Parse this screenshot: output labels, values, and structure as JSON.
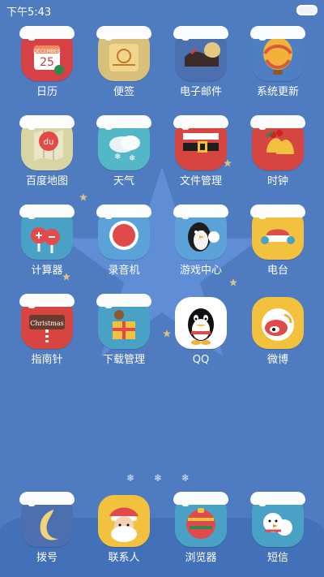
{
  "status_bar": {
    "time": "下午5:43"
  },
  "apps": [
    {
      "label": "日历",
      "icon": "calendar-icon"
    },
    {
      "label": "便签",
      "icon": "note-icon"
    },
    {
      "label": "电子邮件",
      "icon": "mail-icon"
    },
    {
      "label": "系统更新",
      "icon": "update-balloon-icon"
    },
    {
      "label": "百度地图",
      "icon": "map-icon"
    },
    {
      "label": "天气",
      "icon": "weather-icon"
    },
    {
      "label": "文件管理",
      "icon": "file-manager-icon"
    },
    {
      "label": "时钟",
      "icon": "clock-bells-icon"
    },
    {
      "label": "计算器",
      "icon": "calculator-icon"
    },
    {
      "label": "录音机",
      "icon": "recorder-icon"
    },
    {
      "label": "游戏中心",
      "icon": "game-center-icon"
    },
    {
      "label": "电台",
      "icon": "radio-icon"
    },
    {
      "label": "指南针",
      "icon": "compass-sign-icon"
    },
    {
      "label": "下载管理",
      "icon": "download-gift-icon"
    },
    {
      "label": "QQ",
      "icon": "qq-icon"
    },
    {
      "label": "微博",
      "icon": "weibo-icon"
    }
  ],
  "icon_text": {
    "calendar_month": "DECEMBER",
    "calendar_day": "25",
    "baidu": "du",
    "christmas": "Christmas"
  },
  "page_indicator": [
    "❄",
    "❄",
    "❄"
  ],
  "dock": [
    {
      "label": "拨号",
      "icon": "phone-moon-icon"
    },
    {
      "label": "联系人",
      "icon": "contacts-santa-icon"
    },
    {
      "label": "浏览器",
      "icon": "browser-ornament-icon"
    },
    {
      "label": "短信",
      "icon": "messages-snowman-icon"
    }
  ],
  "colors": {
    "background": "#4f7bc0",
    "dock_wave": "#3f6fb7"
  }
}
